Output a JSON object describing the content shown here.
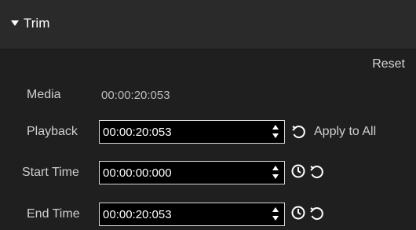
{
  "panel": {
    "title": "Trim",
    "reset_label": "Reset"
  },
  "rows": {
    "media": {
      "label": "Media",
      "value": "00:00:20:053"
    },
    "playback": {
      "label": "Playback",
      "value": "00:00:20:053",
      "apply_all_label": "Apply to All"
    },
    "start_time": {
      "label": "Start Time",
      "value": "00:00:00:000"
    },
    "end_time": {
      "label": "End Time",
      "value": "00:00:20:053"
    }
  },
  "icons": {
    "collapse": "triangle-down-icon",
    "stepper": "spinner-icon",
    "reset": "undo-icon",
    "set_time": "clock-icon"
  }
}
